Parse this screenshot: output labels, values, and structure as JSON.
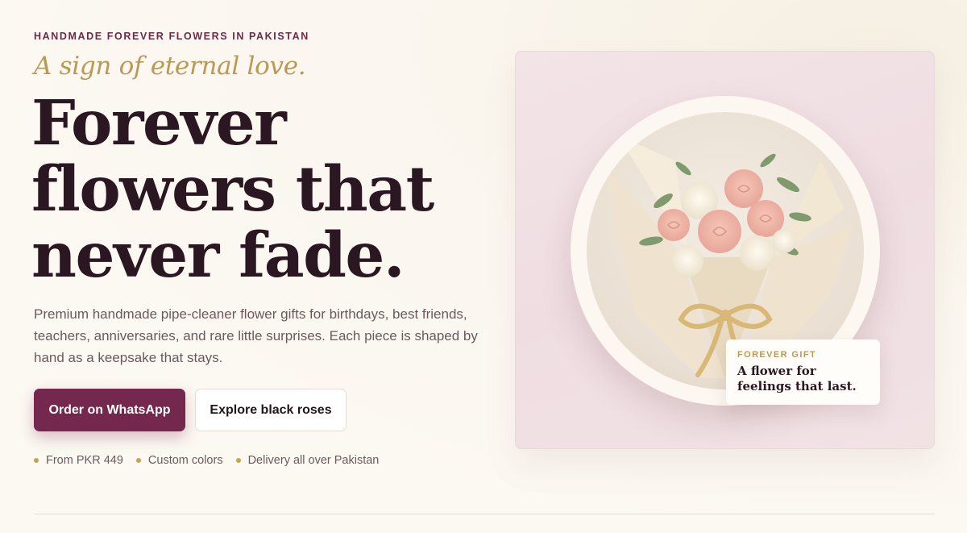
{
  "hero": {
    "eyebrow": "HANDMADE FOREVER FLOWERS IN PAKISTAN",
    "tagline": "A sign of eternal love.",
    "headline_lines": [
      "Forever",
      "flowers that",
      "never fade."
    ],
    "description": "Premium handmade pipe-cleaner flower gifts for birthdays, best friends, teachers, anniversaries, and rare little surprises. Each piece is shaped by hand as a keepsake that stays.",
    "primary_button": "Order on WhatsApp",
    "secondary_button": "Explore black roses",
    "perks": [
      "From PKR 449",
      "Custom colors",
      "Delivery all over Pakistan"
    ]
  },
  "feature_card": {
    "image_icon": "rose-bouquet-photo",
    "badge_kicker": "FOREVER GIFT",
    "badge_lines": [
      "A flower for",
      "feelings that last."
    ]
  },
  "colors": {
    "brand": "#74284e",
    "gold_accent": "#b99a55",
    "headline": "#2b1721",
    "body_text": "#6a5a5f",
    "page_bg": "#fcf9f3",
    "card_bg": "#f0dfe3"
  }
}
